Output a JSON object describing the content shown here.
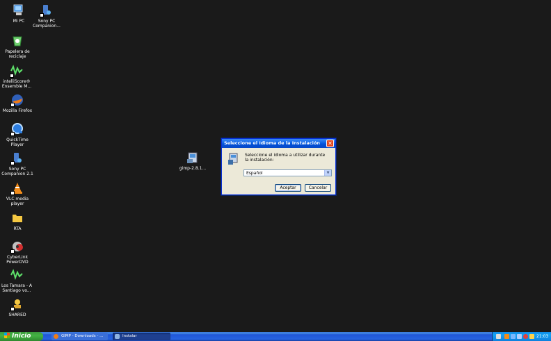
{
  "desktop": {
    "icons": [
      {
        "label": "Mi PC"
      },
      {
        "label": "Sony PC Companion..."
      },
      {
        "label": "Papelera de reciclaje"
      },
      {
        "label": "intelliScore® Ensemble M..."
      },
      {
        "label": "Mozilla Firefox"
      },
      {
        "label": "QuickTime Player"
      },
      {
        "label": "Sony PC Companion 2.1"
      },
      {
        "label": "VLC media player"
      },
      {
        "label": "RTA"
      },
      {
        "label": "CyberLink PowerDVD"
      },
      {
        "label": "Los Tamara - A Santiago vo..."
      },
      {
        "label": "SHARED"
      },
      {
        "label": "gimp-2.8.1..."
      }
    ]
  },
  "dialog": {
    "title": "Seleccione el Idioma de la Instalación",
    "close_label": "✕",
    "prompt": "Seleccione el idioma a utilizar durante la instalación:",
    "language_selected": "Español",
    "ok_label": "Aceptar",
    "cancel_label": "Cancelar"
  },
  "taskbar": {
    "start_label": "Inicio",
    "tasks": [
      {
        "label": "GIMP - Downloads - ..."
      },
      {
        "label": "Instalar"
      }
    ],
    "clock": "21:03"
  }
}
